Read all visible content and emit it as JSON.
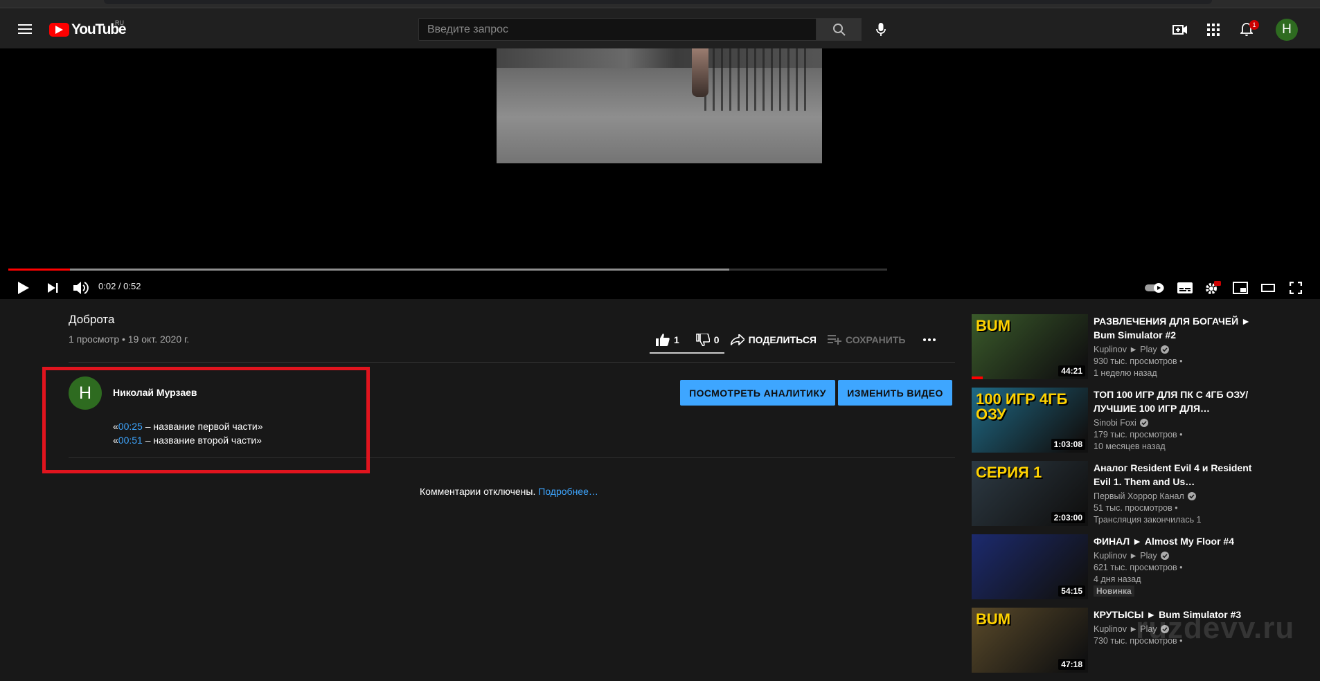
{
  "header": {
    "logo_text": "YouTube",
    "logo_country": "RU",
    "search_placeholder": "Введите запрос",
    "notifications_count": "1",
    "avatar_letter": "Н"
  },
  "player": {
    "time": "0:02 / 0:52",
    "played_fraction": 0.07,
    "loaded_fraction": 0.82
  },
  "video": {
    "title": "Доброта",
    "meta": "1 просмотр • 19 окт. 2020 г.",
    "likes": "1",
    "dislikes": "0",
    "share_label": "ПОДЕЛИТЬСЯ",
    "save_label": "СОХРАНИТЬ"
  },
  "channel": {
    "avatar_letter": "Н",
    "name": "Николай Мурзаев",
    "analytics_button": "ПОСМОТРЕТЬ АНАЛИТИКУ",
    "edit_button": "ИЗМЕНИТЬ ВИДЕО"
  },
  "description": {
    "lines": [
      {
        "open": "«",
        "timestamp": "00:25",
        "text": " – название первой части»"
      },
      {
        "open": "«",
        "timestamp": "00:51",
        "text": " – название второй части»"
      }
    ]
  },
  "comments": {
    "disabled_text": "Комментарии отключены. ",
    "more_link": "Подробнее…"
  },
  "related": [
    {
      "title": "РАЗВЛЕЧЕНИЯ ДЛЯ БОГАЧЕЙ ► Bum Simulator #2",
      "channel": "Kuplinov ► Play",
      "views": "930 тыс. просмотров •",
      "age": "1 неделю назад",
      "duration": "44:21",
      "thumb_text": "BUM",
      "thumb_color": "#3a5a2a"
    },
    {
      "title": "ТОП 100 ИГР ДЛЯ ПК С 4ГБ ОЗУ/ ЛУЧШИЕ 100 ИГР ДЛЯ…",
      "channel": "Sinobi Foxi",
      "views": "179 тыс. просмотров •",
      "age": "10 месяцев назад",
      "duration": "1:03:08",
      "thumb_text": "100 ИГР 4ГБ ОЗУ",
      "thumb_color": "#1f6a86"
    },
    {
      "title": "Аналог Resident Evil 4 и Resident Evil 1. Them and Us…",
      "channel": "Первый Хоррор Канал",
      "views": "51 тыс. просмотров •",
      "age": "Трансляция закончилась 1",
      "duration": "2:03:00",
      "thumb_text": "СЕРИЯ 1",
      "thumb_color": "#2d3a44"
    },
    {
      "title": "ФИНАЛ ► Almost My Floor #4",
      "channel": "Kuplinov ► Play",
      "views": "621 тыс. просмотров •",
      "age": "4 дня назад",
      "badge": "Новинка",
      "duration": "54:15",
      "thumb_text": "",
      "thumb_color": "#1c2a6e"
    },
    {
      "title": "КРУТЫСЫ ► Bum Simulator #3",
      "channel": "Kuplinov ► Play",
      "views": "730 тыс. просмотров •",
      "age": "",
      "duration": "47:18",
      "thumb_text": "BUM",
      "thumb_color": "#5a4a2a"
    }
  ],
  "watermark": "ruzdevv.ru"
}
